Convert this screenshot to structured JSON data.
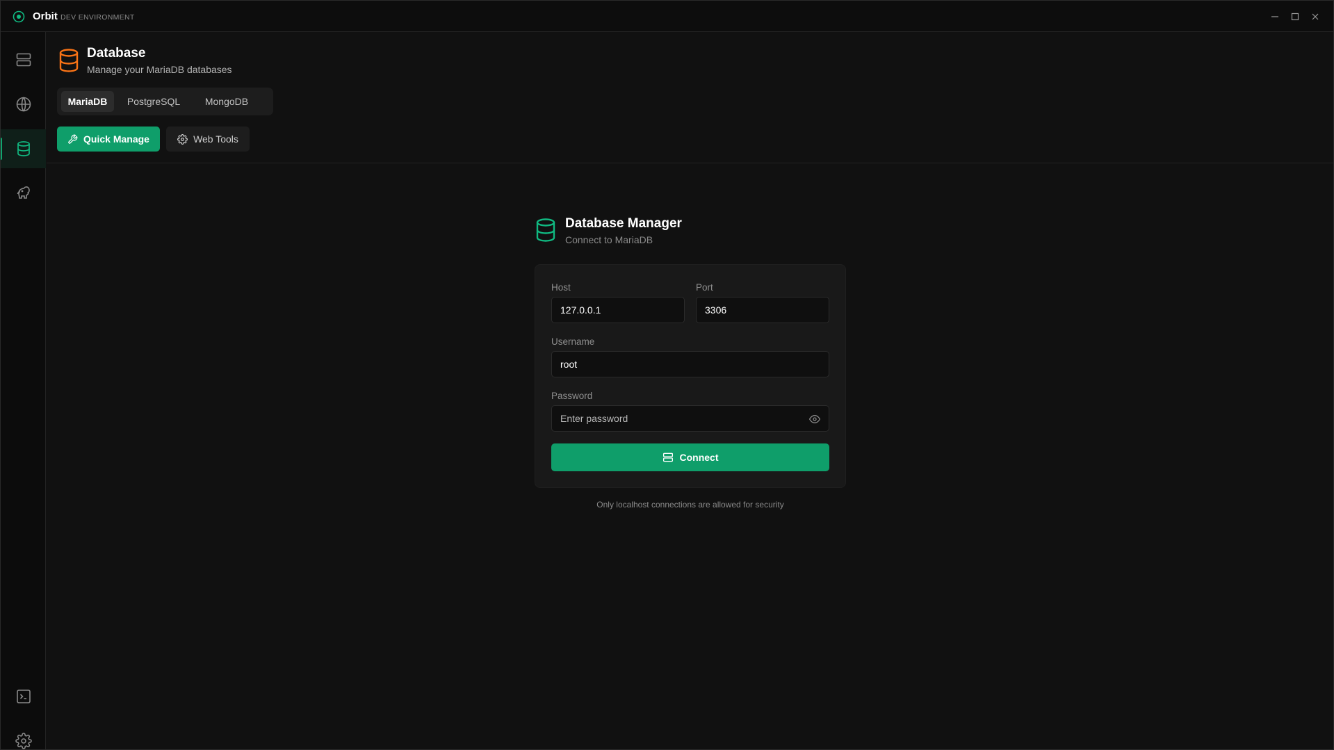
{
  "titlebar": {
    "app_name": "Orbit",
    "environment": "DEV ENVIRONMENT",
    "icons": {
      "logo": "orbit-logo-icon",
      "minimize": "minimize-icon",
      "maximize": "maximize-icon",
      "close": "close-icon"
    }
  },
  "sidebar": {
    "items": [
      {
        "icon": "server-icon",
        "active": false
      },
      {
        "icon": "globe-icon",
        "active": false
      },
      {
        "icon": "database-icon",
        "active": true
      },
      {
        "icon": "php-elephant-icon",
        "active": false
      },
      {
        "icon": "terminal-icon",
        "active": false
      },
      {
        "icon": "gear-icon",
        "active": false
      }
    ]
  },
  "header": {
    "title": "Database",
    "subtitle": "Manage your MariaDB databases",
    "icon": "database-icon"
  },
  "tabs": [
    {
      "label": "MariaDB",
      "active": true
    },
    {
      "label": "PostgreSQL",
      "active": false
    },
    {
      "label": "MongoDB",
      "active": false
    }
  ],
  "actions": {
    "quick_manage_label": "Quick Manage",
    "web_tools_label": "Web Tools"
  },
  "manager": {
    "title": "Database Manager",
    "subtitle": "Connect to MariaDB",
    "host_label": "Host",
    "host_value": "127.0.0.1",
    "port_label": "Port",
    "port_value": "3306",
    "username_label": "Username",
    "username_value": "root",
    "password_label": "Password",
    "password_placeholder": "Enter password",
    "connect_label": "Connect",
    "security_note": "Only localhost connections are allowed for security"
  },
  "colors": {
    "accent": "#0f9e6a",
    "accent_icon": "#10b981",
    "header_icon": "#f97316",
    "background": "#111111"
  }
}
